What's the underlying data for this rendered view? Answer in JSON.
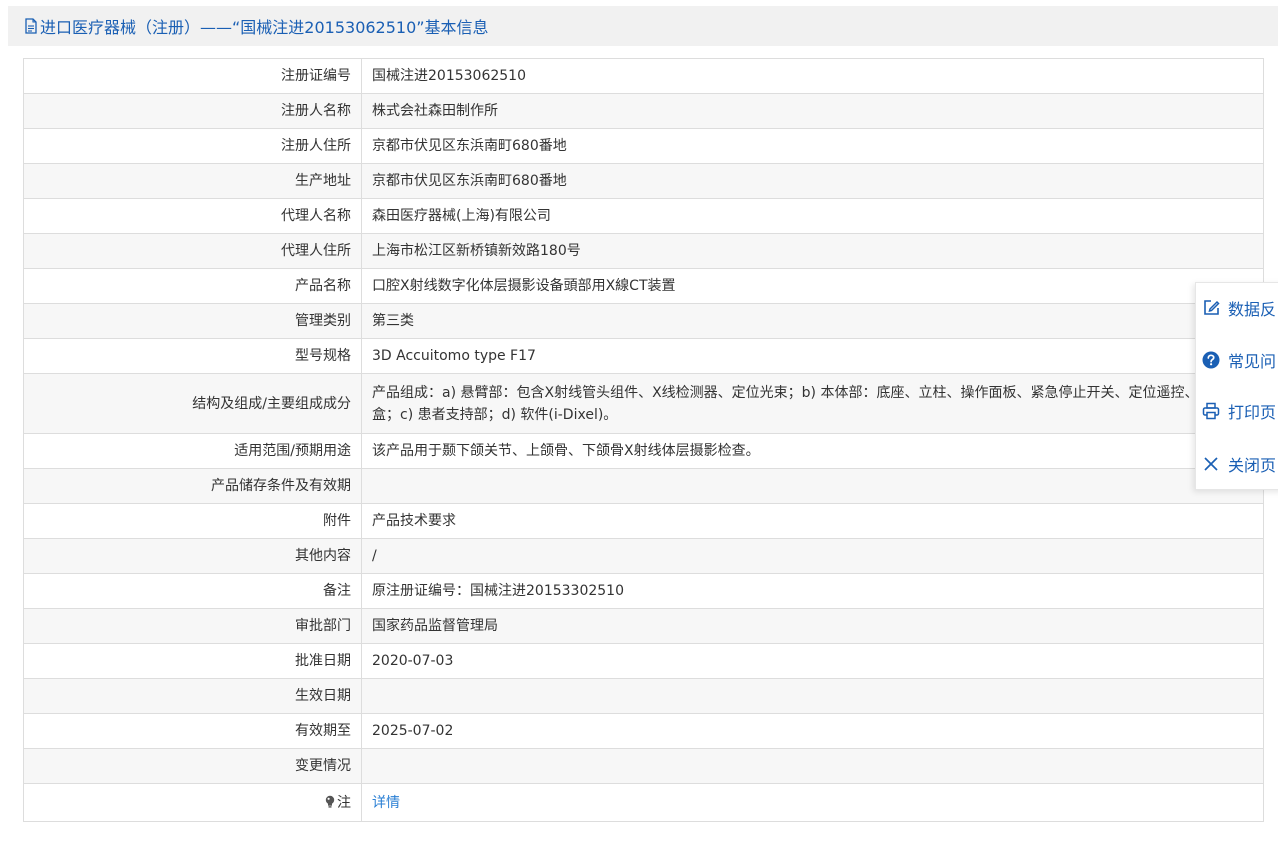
{
  "header": {
    "title": "进口医疗器械（注册）——“国械注进20153062510”基本信息"
  },
  "rows": [
    {
      "label": "注册证编号",
      "value": "国械注进20153062510"
    },
    {
      "label": "注册人名称",
      "value": "株式会社森田制作所"
    },
    {
      "label": "注册人住所",
      "value": "京都市伏见区东浜南町680番地"
    },
    {
      "label": "生产地址",
      "value": "京都市伏见区东浜南町680番地"
    },
    {
      "label": "代理人名称",
      "value": "森田医疗器械(上海)有限公司"
    },
    {
      "label": "代理人住所",
      "value": "上海市松江区新桥镇新效路180号"
    },
    {
      "label": "产品名称",
      "value": "口腔X射线数字化体层摄影设备頭部用X線CT装置"
    },
    {
      "label": "管理类别",
      "value": "第三类"
    },
    {
      "label": "型号规格",
      "value": "3D Accuitomo type F17"
    },
    {
      "label": "结构及组成/主要组成成分",
      "value": "产品组成：a) 悬臂部：包含X射线管头组件、X线检测器、定位光束；b) 本体部：底座、立柱、操作面板、紧急停止开关、定位遥控、控制盒；c) 患者支持部；d) 软件(i-Dixel)。"
    },
    {
      "label": "适用范围/预期用途",
      "value": "该产品用于颞下颌关节、上颌骨、下颌骨X射线体层摄影检查。"
    },
    {
      "label": "产品储存条件及有效期",
      "value": ""
    },
    {
      "label": "附件",
      "value": "产品技术要求"
    },
    {
      "label": "其他内容",
      "value": "/"
    },
    {
      "label": "备注",
      "value": "原注册证编号：国械注进20153302510"
    },
    {
      "label": "审批部门",
      "value": "国家药品监督管理局"
    },
    {
      "label": "批准日期",
      "value": "2020-07-03"
    },
    {
      "label": "生效日期",
      "value": ""
    },
    {
      "label": "有效期至",
      "value": "2025-07-02"
    },
    {
      "label": "变更情况",
      "value": ""
    },
    {
      "label": "注",
      "value": "详情"
    }
  ],
  "side_panel": {
    "items": [
      {
        "label": "数据反",
        "icon": "edit-icon"
      },
      {
        "label": "常见问",
        "icon": "question-icon"
      },
      {
        "label": "打印页",
        "icon": "print-icon"
      },
      {
        "label": "关闭页",
        "icon": "close-icon"
      }
    ]
  },
  "colors": {
    "link": "#2a7fd4",
    "title": "#1a5fb4",
    "icon_blue": "#1a5fb4",
    "border": "#dddddd",
    "alt_row": "#f7f7f7"
  }
}
